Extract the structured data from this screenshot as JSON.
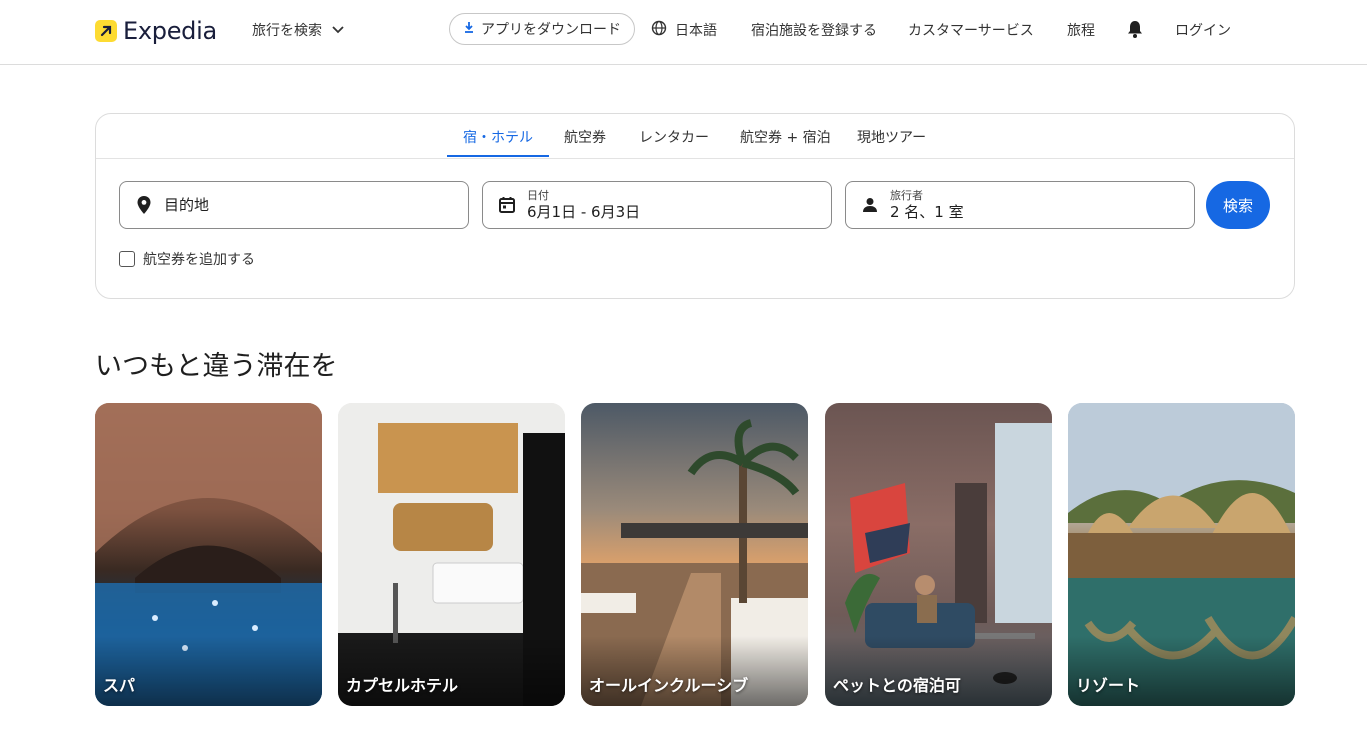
{
  "header": {
    "logo_text": "Expedia",
    "trip_search": "旅行を検索",
    "app_download": "アプリをダウンロード",
    "language": "日本語",
    "list_property": "宿泊施設を登録する",
    "customer_service": "カスタマーサービス",
    "trips": "旅程",
    "login": "ログイン"
  },
  "search": {
    "tabs": [
      {
        "label": "宿・ホテル",
        "active": true
      },
      {
        "label": "航空券"
      },
      {
        "label": "レンタカー"
      },
      {
        "label": "航空券 + 宿泊"
      },
      {
        "label": "現地ツアー"
      }
    ],
    "destination_placeholder": "目的地",
    "dates_label": "日付",
    "dates_value": "6月1日 - 6月3日",
    "travelers_label": "旅行者",
    "travelers_value": "2 名、1 室",
    "search_button": "検索",
    "add_flight": "航空券を追加する"
  },
  "section": {
    "title": "いつもと違う滞在を",
    "tiles": [
      {
        "label": "スパ"
      },
      {
        "label": "カプセルホテル"
      },
      {
        "label": "オールインクルーシブ"
      },
      {
        "label": "ペットとの宿泊可"
      },
      {
        "label": "リゾート"
      }
    ]
  },
  "colors": {
    "accent": "#1668e3",
    "logo_yellow": "#fddb32",
    "brand_navy": "#191e3b"
  }
}
